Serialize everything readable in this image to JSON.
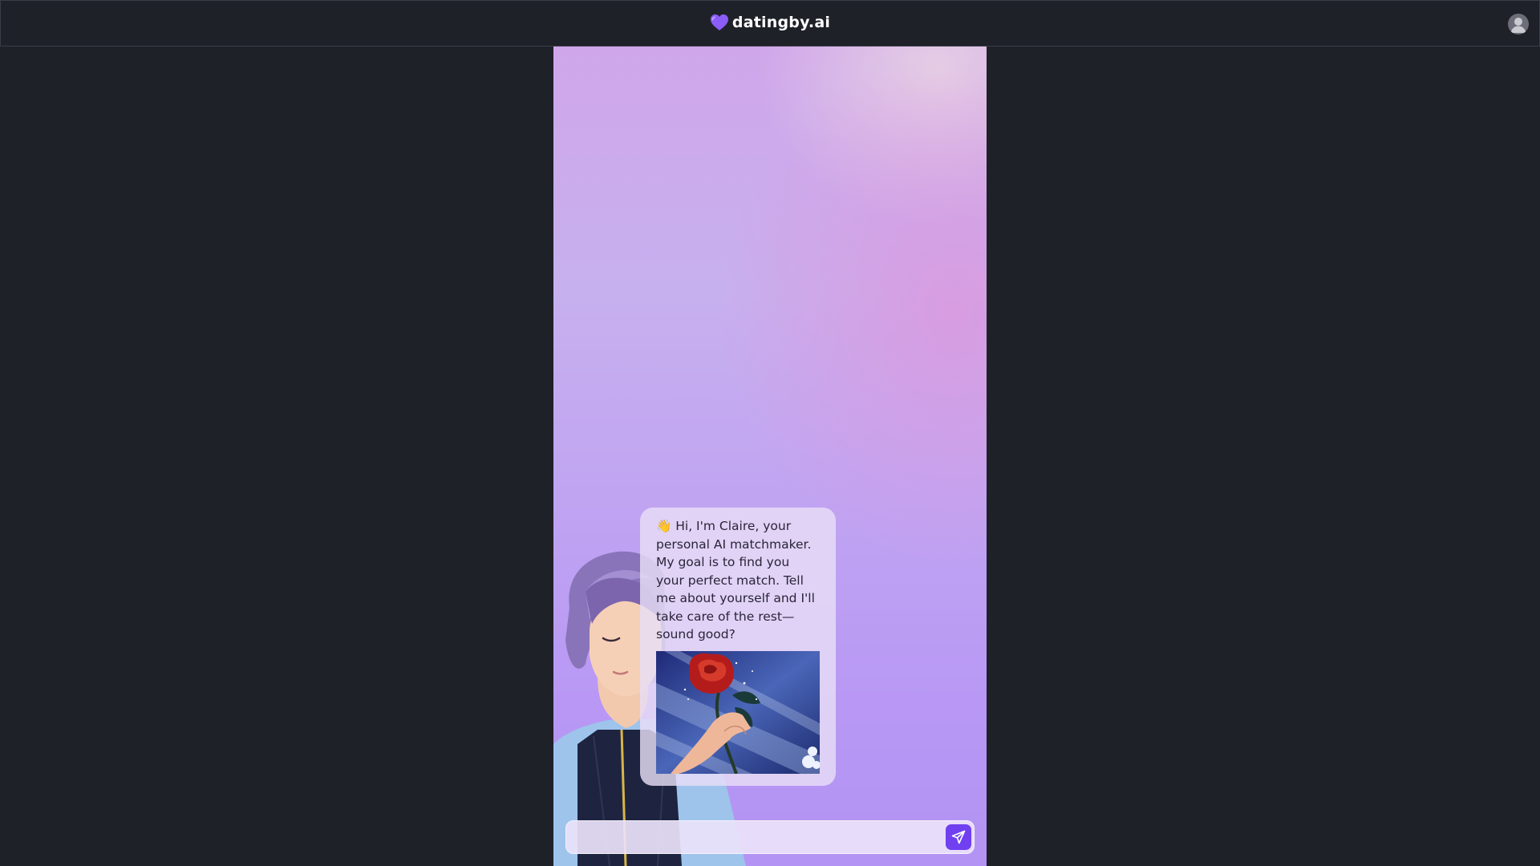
{
  "header": {
    "brand_name": "datingby.ai",
    "logo_icon": "purple-heart-icon",
    "account_icon": "user-avatar-icon"
  },
  "chat": {
    "assistant_message": "👋 Hi, I'm Claire, your personal AI matchmaker. My goal is to find you your perfect match. Tell me about yourself and I'll take care of the rest—sound good?",
    "message_image": "hand-holding-red-rose-illustration",
    "character": "claire-3d-character"
  },
  "composer": {
    "placeholder": "",
    "value": "",
    "send_icon": "paper-plane-icon"
  },
  "colors": {
    "accent": "#6f3ff0",
    "page_background": "#1f2129",
    "heart": "#8b5cf6"
  }
}
